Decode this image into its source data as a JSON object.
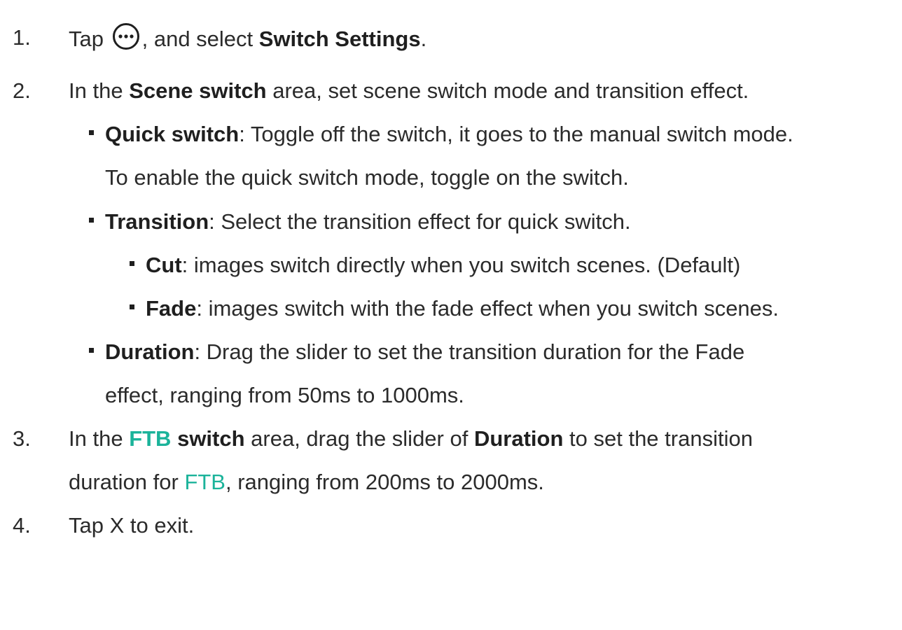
{
  "steps": [
    {
      "num": "1.",
      "pre": "Tap",
      "icon": "more-icon",
      "post": ", and select ",
      "bold": "Switch Settings",
      "end": "."
    },
    {
      "num": "2.",
      "pre": "In the ",
      "bold": "Scene switch",
      "post": " area, set scene switch mode and transition effect."
    },
    {
      "num": "3.",
      "pre": "In the ",
      "teal_bold": "FTB",
      "bold": "switch",
      "post": " area, drag the slider of ",
      "bold2": "Duration",
      "post2": " to set the transition",
      "line2_pre": "duration for ",
      "line2_teal": "FTB",
      "line2_post": ", ranging from 200ms to 2000ms."
    },
    {
      "num": "4.",
      "text": "Tap X to exit."
    }
  ],
  "bullets": [
    {
      "bold": "Quick switch",
      "text": ": Toggle off the switch, it goes to the manual switch mode.",
      "line2": "To enable the quick switch mode, toggle on the switch."
    },
    {
      "bold": "Transition",
      "text": ": Select the transition effect for quick switch."
    },
    {
      "bold": "Cut",
      "text": ": images switch directly when you switch scenes. (Default)"
    },
    {
      "bold": "Fade",
      "text": ": images switch with the fade effect when you switch scenes."
    },
    {
      "bold": "Duration",
      "text": ": Drag the slider to set the transition duration for the Fade",
      "line2": "effect, ranging from 50ms to 1000ms."
    }
  ]
}
